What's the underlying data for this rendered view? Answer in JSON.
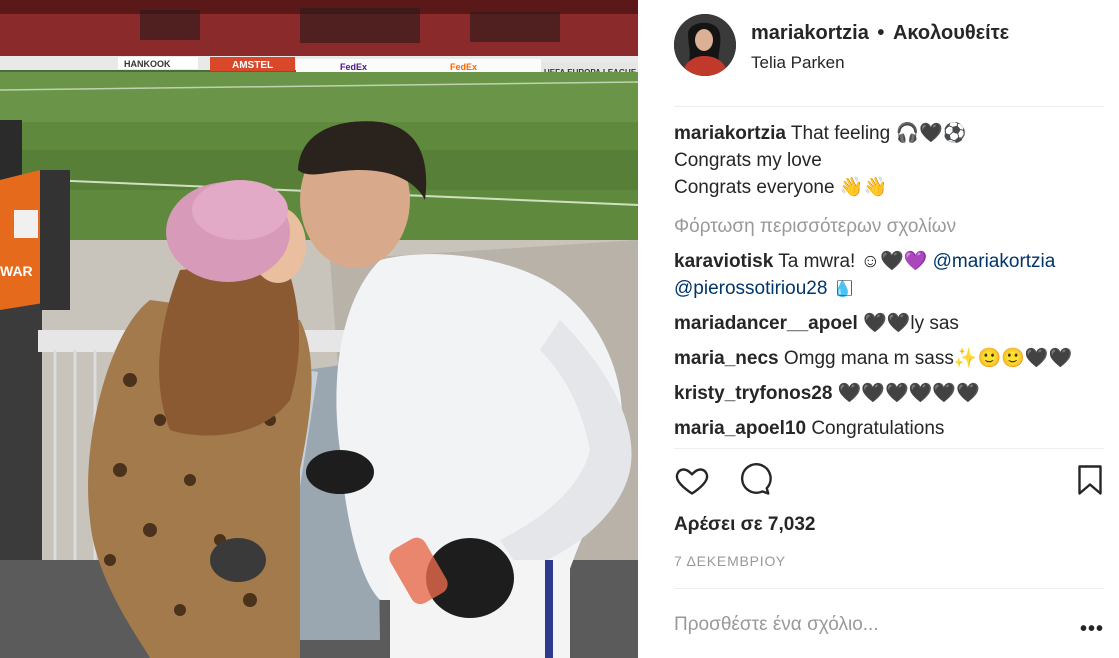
{
  "post": {
    "username": "mariakortzia",
    "separator": "•",
    "follow_label": "Ακολουθείτε",
    "location": "Telia Parken",
    "photo_signs": {
      "sign_1": "HANKOOK",
      "sign_2": "AMSTEL",
      "sign_3": "FedEx",
      "sign_4": "UEFA EUROPA LEAGUE",
      "vest_text": "WAR"
    }
  },
  "caption": {
    "username": "mariakortzia",
    "line1": "That feeling 🎧🖤⚽",
    "line2": "Congrats my love",
    "line3": "Congrats everyone 👋👋"
  },
  "load_more_label": "Φόρτωση περισσότερων σχολίων",
  "comments": [
    {
      "user": "karaviotisk",
      "text": "Ta mwra! ☺🖤💜",
      "mention1": "@mariakortzia",
      "mention2": "@pierossotiriou28",
      "tail": "💧⃞⃞"
    },
    {
      "user": "mariadancer__apoel",
      "text": "🖤🖤ly sas"
    },
    {
      "user": "maria_necs",
      "text": "Omgg mana m sass✨🙂🙂🖤🖤"
    },
    {
      "user": "kristy_tryfonos28",
      "text": "🖤🖤🖤🖤🖤🖤"
    },
    {
      "user": "maria_apoel10",
      "text": "Congratulations"
    }
  ],
  "actions": {
    "like_icon": "heart-icon",
    "comment_icon": "comment-bubble-icon",
    "save_icon": "bookmark-icon"
  },
  "likes_label": "Αρέσει σε 7,032",
  "date_label": "7 ΔΕΚΕΜΒΡΙΟΥ",
  "add_comment": {
    "placeholder": "Προσθέστε ένα σχόλιο..."
  },
  "more_label": "•••",
  "colors": {
    "text": "#262626",
    "muted": "#999999",
    "mention": "#003569",
    "divider": "#efefef"
  }
}
